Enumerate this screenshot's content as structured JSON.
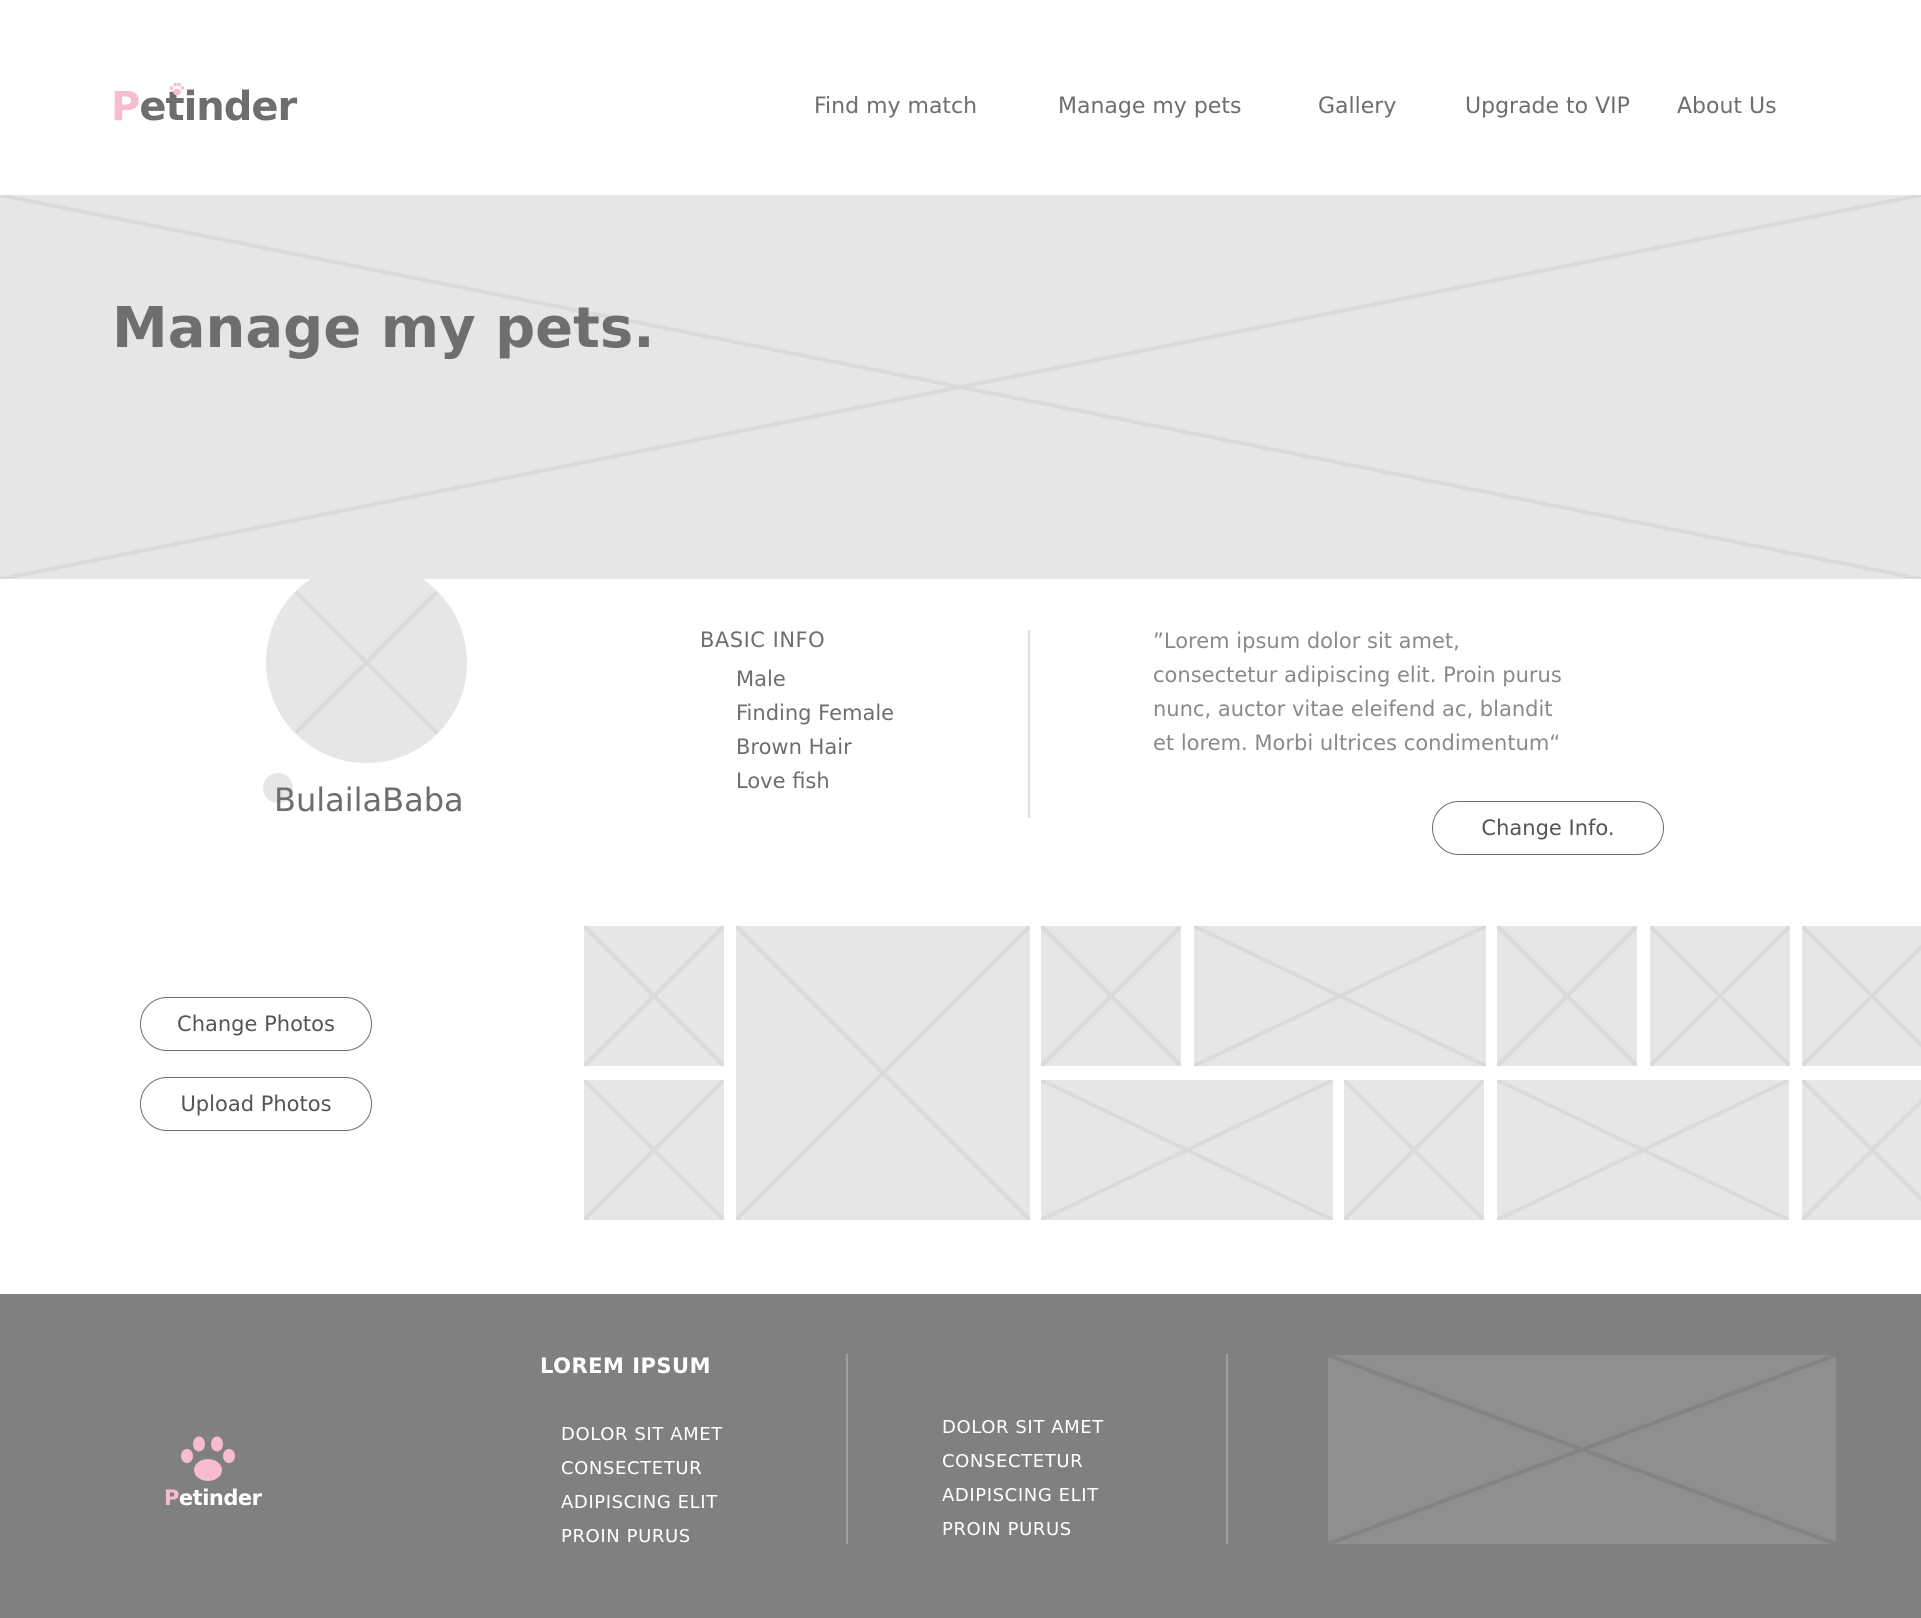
{
  "brand": {
    "logo_first_letter": "P",
    "logo_rest": "etinder",
    "accent_color": "#f7bcd0",
    "text_color": "#6e6e6e"
  },
  "nav": {
    "items": [
      {
        "label": "Find my match"
      },
      {
        "label": "Manage my pets"
      },
      {
        "label": "Gallery"
      },
      {
        "label": "Upgrade to VIP"
      },
      {
        "label": "About Us"
      }
    ]
  },
  "hero": {
    "title": "Manage my pets."
  },
  "profile": {
    "pet_name": "BulailaBaba",
    "basic_info": {
      "heading": "BASIC INFO",
      "items": [
        "Male",
        "Finding Female",
        "Brown Hair",
        "Love fish"
      ]
    },
    "quote": "”Lorem ipsum dolor sit amet, consectetur adipiscing elit. Proin purus nunc, auctor vitae eleifend ac, blandit et lorem. Morbi ultrices condimentum“",
    "change_info_label": "Change Info."
  },
  "gallery": {
    "change_photos_label": "Change Photos",
    "upload_photos_label": "Upload Photos"
  },
  "footer": {
    "logo_first_letter": "P",
    "logo_rest": "etinder",
    "heading": "LOREM IPSUM",
    "column1": [
      "DOLOR SIT AMET",
      "CONSECTETUR",
      "ADIPISCING ELIT",
      "PROIN PURUS"
    ],
    "column2": [
      "DOLOR SIT AMET",
      "CONSECTETUR",
      "ADIPISCING ELIT",
      "PROIN PURUS"
    ],
    "background_color": "#808080"
  }
}
